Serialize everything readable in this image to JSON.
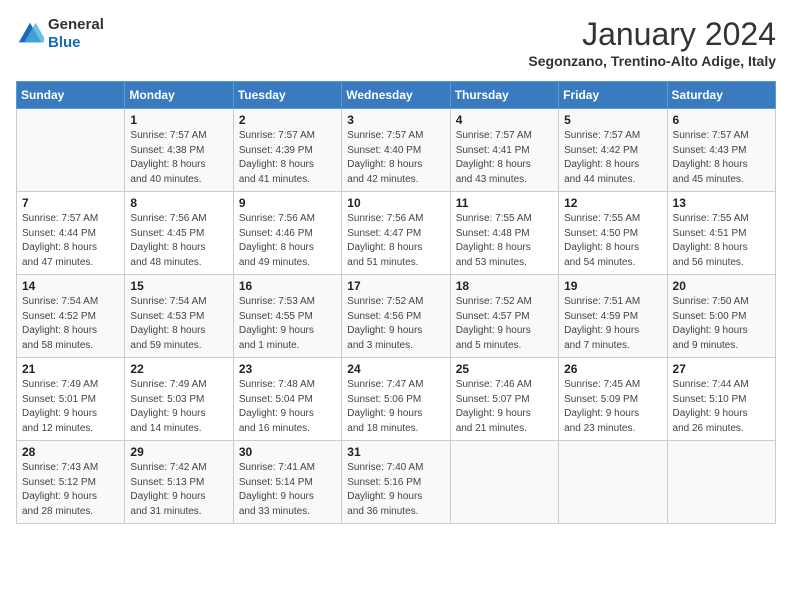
{
  "header": {
    "logo_line1": "General",
    "logo_line2": "Blue",
    "month": "January 2024",
    "location": "Segonzano, Trentino-Alto Adige, Italy"
  },
  "weekdays": [
    "Sunday",
    "Monday",
    "Tuesday",
    "Wednesday",
    "Thursday",
    "Friday",
    "Saturday"
  ],
  "weeks": [
    [
      {
        "day": "",
        "info": ""
      },
      {
        "day": "1",
        "info": "Sunrise: 7:57 AM\nSunset: 4:38 PM\nDaylight: 8 hours\nand 40 minutes."
      },
      {
        "day": "2",
        "info": "Sunrise: 7:57 AM\nSunset: 4:39 PM\nDaylight: 8 hours\nand 41 minutes."
      },
      {
        "day": "3",
        "info": "Sunrise: 7:57 AM\nSunset: 4:40 PM\nDaylight: 8 hours\nand 42 minutes."
      },
      {
        "day": "4",
        "info": "Sunrise: 7:57 AM\nSunset: 4:41 PM\nDaylight: 8 hours\nand 43 minutes."
      },
      {
        "day": "5",
        "info": "Sunrise: 7:57 AM\nSunset: 4:42 PM\nDaylight: 8 hours\nand 44 minutes."
      },
      {
        "day": "6",
        "info": "Sunrise: 7:57 AM\nSunset: 4:43 PM\nDaylight: 8 hours\nand 45 minutes."
      }
    ],
    [
      {
        "day": "7",
        "info": "Sunrise: 7:57 AM\nSunset: 4:44 PM\nDaylight: 8 hours\nand 47 minutes."
      },
      {
        "day": "8",
        "info": "Sunrise: 7:56 AM\nSunset: 4:45 PM\nDaylight: 8 hours\nand 48 minutes."
      },
      {
        "day": "9",
        "info": "Sunrise: 7:56 AM\nSunset: 4:46 PM\nDaylight: 8 hours\nand 49 minutes."
      },
      {
        "day": "10",
        "info": "Sunrise: 7:56 AM\nSunset: 4:47 PM\nDaylight: 8 hours\nand 51 minutes."
      },
      {
        "day": "11",
        "info": "Sunrise: 7:55 AM\nSunset: 4:48 PM\nDaylight: 8 hours\nand 53 minutes."
      },
      {
        "day": "12",
        "info": "Sunrise: 7:55 AM\nSunset: 4:50 PM\nDaylight: 8 hours\nand 54 minutes."
      },
      {
        "day": "13",
        "info": "Sunrise: 7:55 AM\nSunset: 4:51 PM\nDaylight: 8 hours\nand 56 minutes."
      }
    ],
    [
      {
        "day": "14",
        "info": "Sunrise: 7:54 AM\nSunset: 4:52 PM\nDaylight: 8 hours\nand 58 minutes."
      },
      {
        "day": "15",
        "info": "Sunrise: 7:54 AM\nSunset: 4:53 PM\nDaylight: 8 hours\nand 59 minutes."
      },
      {
        "day": "16",
        "info": "Sunrise: 7:53 AM\nSunset: 4:55 PM\nDaylight: 9 hours\nand 1 minute."
      },
      {
        "day": "17",
        "info": "Sunrise: 7:52 AM\nSunset: 4:56 PM\nDaylight: 9 hours\nand 3 minutes."
      },
      {
        "day": "18",
        "info": "Sunrise: 7:52 AM\nSunset: 4:57 PM\nDaylight: 9 hours\nand 5 minutes."
      },
      {
        "day": "19",
        "info": "Sunrise: 7:51 AM\nSunset: 4:59 PM\nDaylight: 9 hours\nand 7 minutes."
      },
      {
        "day": "20",
        "info": "Sunrise: 7:50 AM\nSunset: 5:00 PM\nDaylight: 9 hours\nand 9 minutes."
      }
    ],
    [
      {
        "day": "21",
        "info": "Sunrise: 7:49 AM\nSunset: 5:01 PM\nDaylight: 9 hours\nand 12 minutes."
      },
      {
        "day": "22",
        "info": "Sunrise: 7:49 AM\nSunset: 5:03 PM\nDaylight: 9 hours\nand 14 minutes."
      },
      {
        "day": "23",
        "info": "Sunrise: 7:48 AM\nSunset: 5:04 PM\nDaylight: 9 hours\nand 16 minutes."
      },
      {
        "day": "24",
        "info": "Sunrise: 7:47 AM\nSunset: 5:06 PM\nDaylight: 9 hours\nand 18 minutes."
      },
      {
        "day": "25",
        "info": "Sunrise: 7:46 AM\nSunset: 5:07 PM\nDaylight: 9 hours\nand 21 minutes."
      },
      {
        "day": "26",
        "info": "Sunrise: 7:45 AM\nSunset: 5:09 PM\nDaylight: 9 hours\nand 23 minutes."
      },
      {
        "day": "27",
        "info": "Sunrise: 7:44 AM\nSunset: 5:10 PM\nDaylight: 9 hours\nand 26 minutes."
      }
    ],
    [
      {
        "day": "28",
        "info": "Sunrise: 7:43 AM\nSunset: 5:12 PM\nDaylight: 9 hours\nand 28 minutes."
      },
      {
        "day": "29",
        "info": "Sunrise: 7:42 AM\nSunset: 5:13 PM\nDaylight: 9 hours\nand 31 minutes."
      },
      {
        "day": "30",
        "info": "Sunrise: 7:41 AM\nSunset: 5:14 PM\nDaylight: 9 hours\nand 33 minutes."
      },
      {
        "day": "31",
        "info": "Sunrise: 7:40 AM\nSunset: 5:16 PM\nDaylight: 9 hours\nand 36 minutes."
      },
      {
        "day": "",
        "info": ""
      },
      {
        "day": "",
        "info": ""
      },
      {
        "day": "",
        "info": ""
      }
    ]
  ]
}
